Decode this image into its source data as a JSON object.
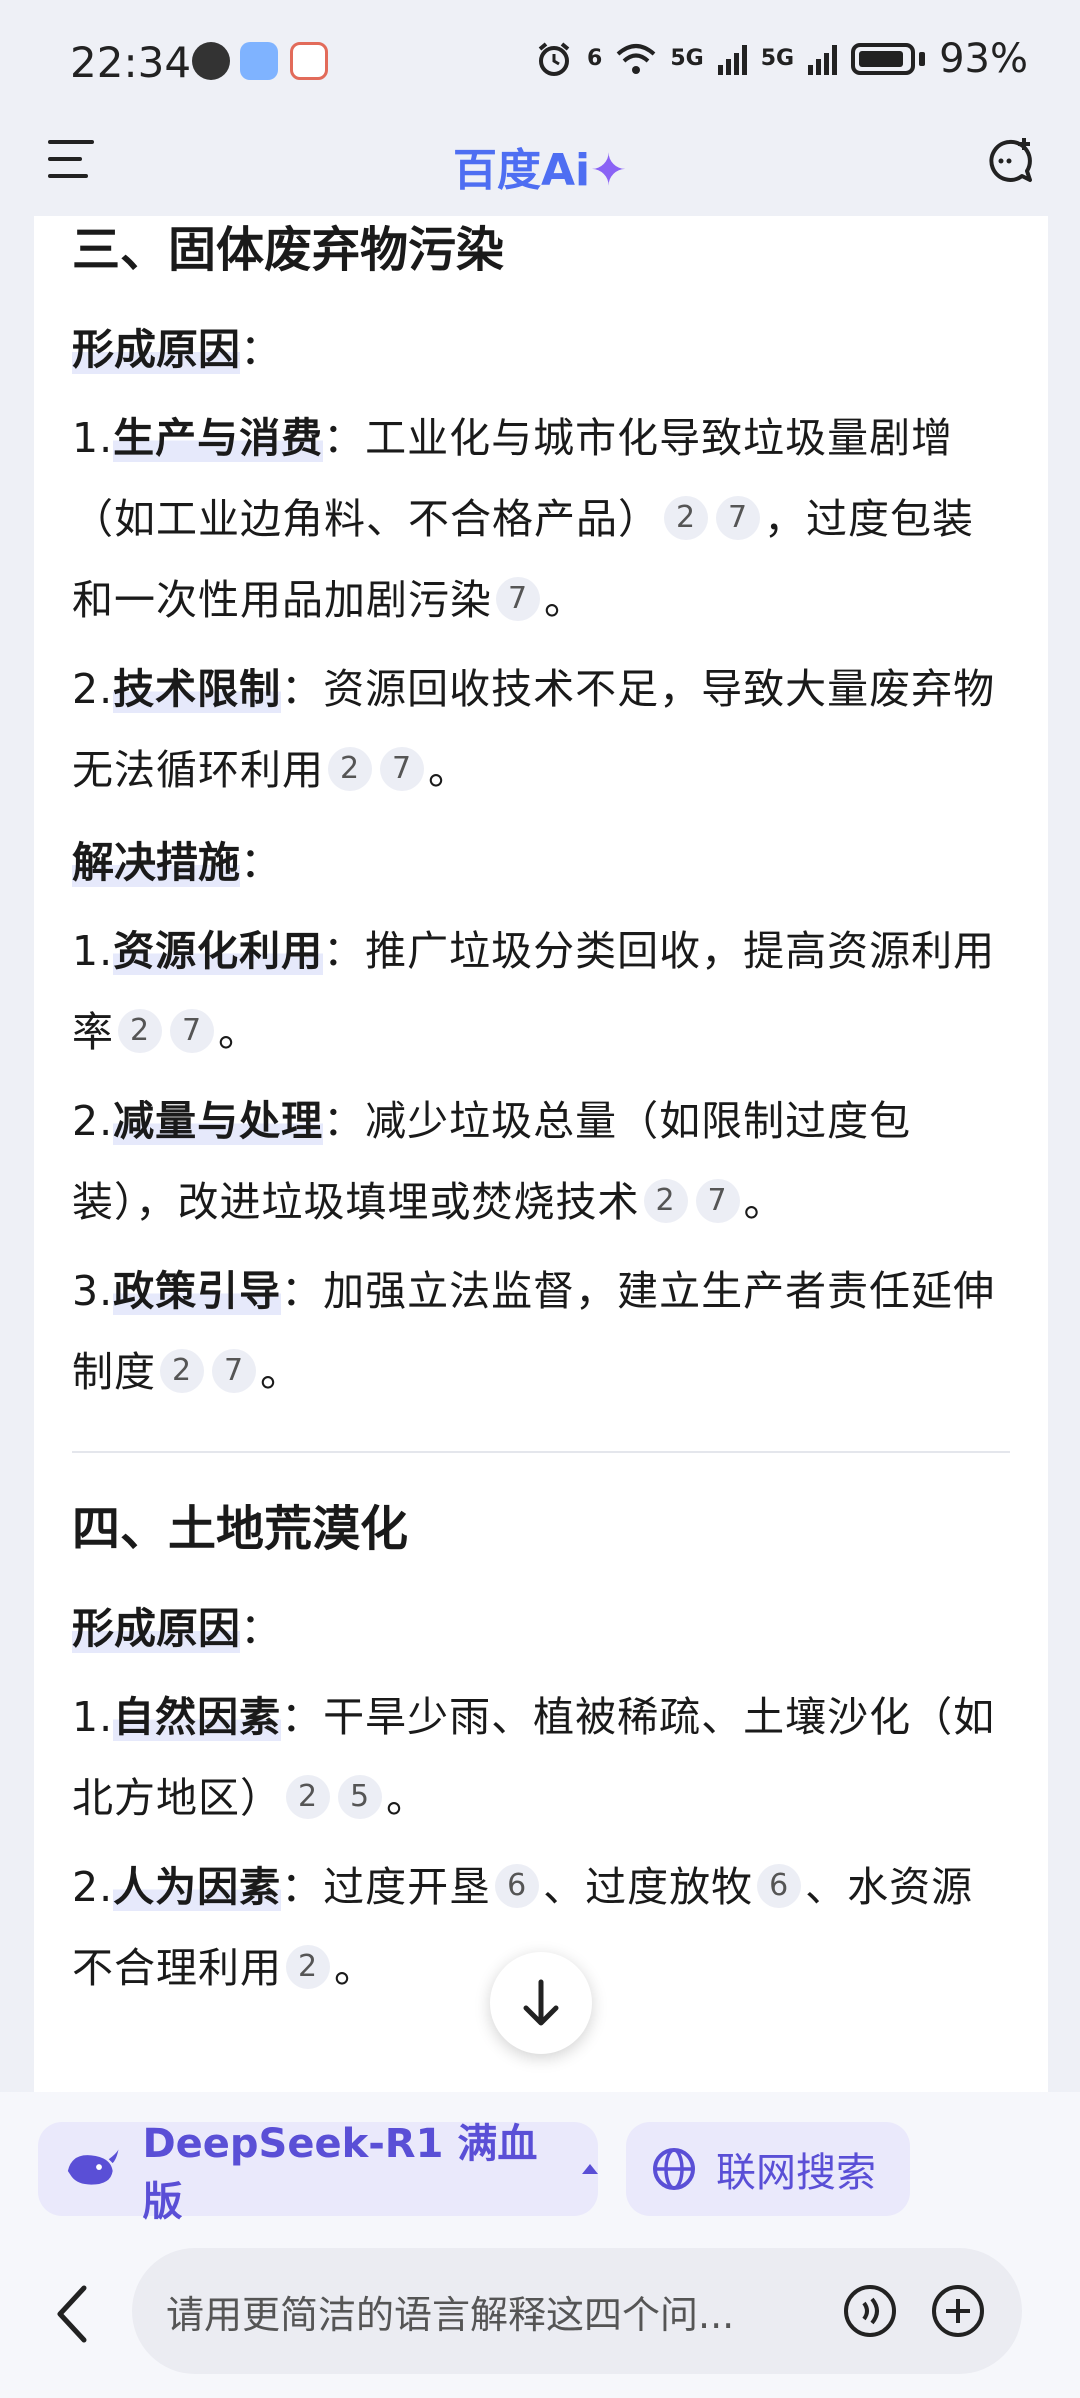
{
  "status_bar": {
    "time": "22:34",
    "network_1": "6",
    "network_2": "5G",
    "network_3": "5G",
    "battery": "93%"
  },
  "header": {
    "logo_text": "百度Ai",
    "logo_spark": "✦"
  },
  "section3": {
    "title": "三、固体废弃物污染",
    "causes_label": "形成原因",
    "causes": [
      {
        "num": "1.",
        "bold": "生产与消费",
        "text1": "：工业化与城市化导致垃圾量剧增（如工业边角料、不合格产品）",
        "c1": "2",
        "c2": "7",
        "text2": "，过度包装和一次性用品加剧污染",
        "c3": "7",
        "end": "。"
      },
      {
        "num": "2.",
        "bold": "技术限制",
        "text1": "：资源回收技术不足，导致大量废弃物无法循环利用",
        "c1": "2",
        "c2": "7",
        "end": "。"
      }
    ],
    "solutions_label": "解决措施",
    "solutions": [
      {
        "num": "1.",
        "bold": "资源化利用",
        "text1": "：推广垃圾分类回收，提高资源利用率",
        "c1": "2",
        "c2": "7",
        "end": "。"
      },
      {
        "num": "2.",
        "bold": "减量与处理",
        "text1": "：减少垃圾总量（如限制过度包装），改进垃圾填埋或焚烧技术",
        "c1": "2",
        "c2": "7",
        "end": "。"
      },
      {
        "num": "3.",
        "bold": "政策引导",
        "text1": "：加强立法监督，建立生产者责任延伸制度",
        "c1": "2",
        "c2": "7",
        "end": "。"
      }
    ]
  },
  "section4": {
    "title": "四、土地荒漠化",
    "causes_label": "形成原因",
    "causes": [
      {
        "num": "1.",
        "bold": "自然因素",
        "text1": "：干旱少雨、植被稀疏、土壤沙化（如北方地区）",
        "c1": "2",
        "c2": "5",
        "end": "。"
      },
      {
        "num": "2.",
        "bold": "人为因素",
        "text1": "：过度开垦",
        "c1": "6",
        "text2": "、过度放牧",
        "c2": "6",
        "text3": "、水资源不合理利用",
        "c3": "2",
        "end": "。"
      }
    ]
  },
  "colon": "：",
  "bottom": {
    "model_chip": "DeepSeek-R1 满血版",
    "web_search_chip": "联网搜索",
    "input_value": "请用更简洁的语言解释这四个问..."
  },
  "colors": {
    "accent": "#4e6ef2",
    "chip_text": "#5a4fd6",
    "chip_bg": "#eae9fb"
  }
}
